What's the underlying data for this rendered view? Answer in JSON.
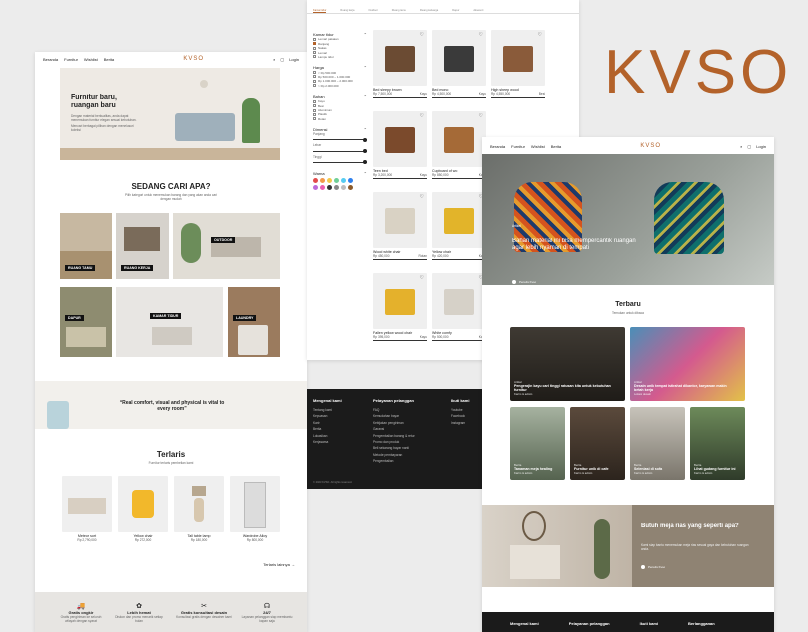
{
  "brand": {
    "logo": "KVSO",
    "accent": "#b3622a"
  },
  "nav": {
    "links": [
      "Beranda",
      "Furnitur",
      "Wishlist",
      "Berita"
    ],
    "login": "Login"
  },
  "home": {
    "hero_title": "Furnitur baru, ruangan baru",
    "hero_text": "Dengan material berkualitas, anda dapat menemukan furnitur elegan sesuai kebutuhan.",
    "hero_text2": "Mencari berbagai pilihan dengan menelusuri koleksi",
    "search_heading": "SEDANG CARI APA?",
    "search_sub": "Pilih kategori untuk menemukan barang dan yang akan anda cari dengan mudah",
    "rooms": [
      "RUANG TAMU",
      "RUANG KERJA",
      "OUTDOOR",
      "DAPUR",
      "KAMAR TIDUR",
      "LAUNDRY"
    ],
    "quote": "“Real comfort, visual and physical is vital to every room”",
    "bestseller_title": "Terlaris",
    "bestseller_sub": "Furnitur terlaris pembelian kami",
    "bestsellers": [
      {
        "name": "Meteor sort",
        "price": "Rp 2,790,000"
      },
      {
        "name": "Yellow chair",
        "price": "Rp 272,000"
      },
      {
        "name": "Tall table lamp",
        "price": "Rp 180,000"
      },
      {
        "name": "Wardrobe Alloy",
        "price": "Rp 800,000"
      }
    ],
    "see_more": "Terlaris lainnya  →",
    "features": [
      {
        "title": "Gratis ongkir",
        "text": "Gratis pengiriman ke seluruh wilayah dengan syarat"
      },
      {
        "title": "Lebih hemat",
        "text": "Diskon dan promo menarik setiap bulan"
      },
      {
        "title": "Gratis konsultasi desain",
        "text": "Konsultasi gratis dengan desainer kami"
      },
      {
        "title": "24/7",
        "text": "Layanan pelanggan siap membantu kapan saja"
      }
    ]
  },
  "catalog": {
    "tabs": [
      "Kamar tidur",
      "Ruang kerja",
      "Outdoor",
      "Ruang tamu",
      "Ruang keluarga",
      "Dapur",
      "Aksesori"
    ],
    "filters": {
      "kamar_tidur_label": "Kamar tidur",
      "kamar_tidur_items": [
        "Lemari pakaian",
        "Ranjang",
        "Nakas",
        "Lemari",
        "Lampu tidur"
      ],
      "harga_label": "Harga",
      "harga_items": [
        "< Rp 500.000",
        "Rp 500.000 – 1.000.000",
        "Rp 1.000.000 – 2.000.000",
        "> Rp 2.000.000"
      ],
      "bahan_label": "Bahan",
      "bahan_items": [
        "Kayu",
        "Besi",
        "Aluminium",
        "Plastik",
        "Rotan"
      ],
      "dimensi_label": "Dimensi",
      "panjang": "Panjang",
      "lebar": "Lebar",
      "tinggi": "Tinggi",
      "warna_label": "Warna"
    },
    "products": [
      {
        "name": "Bed sleepy brown",
        "price": "Rp 7,500,000",
        "tag": "Kayu"
      },
      {
        "name": "Bed mono",
        "price": "Rp 4,500,000",
        "tag": "Kayu"
      },
      {
        "name": "High sheep wood",
        "price": "Rp 4,550,000",
        "tag": "Besi"
      },
      {
        "name": "Teen bed",
        "price": "Rp 3,200,000",
        "tag": "Kayu"
      },
      {
        "name": "Cupboard of wo",
        "price": "Rp 850,000",
        "tag": "Kayu"
      },
      {
        "name": "",
        "price": "",
        "tag": ""
      },
      {
        "name": "Wood white chair",
        "price": "Rp 450,000",
        "tag": "Rotan"
      },
      {
        "name": "Yellow chair",
        "price": "Rp 420,000",
        "tag": "Kayu"
      },
      {
        "name": "",
        "price": "",
        "tag": ""
      },
      {
        "name": "Fallen yellow wood chair",
        "price": "Rp 395,000",
        "tag": "Kayu"
      },
      {
        "name": "White comfy",
        "price": "Rp 500,000",
        "tag": "Kayu"
      }
    ],
    "swatches": [
      "#e24b4b",
      "#f2994a",
      "#f2c94c",
      "#6fcf97",
      "#56ccf2",
      "#2f80ed",
      "#bb6bd9",
      "#eb5fb0",
      "#333333",
      "#888888",
      "#bdbdbd",
      "#8b5a2b"
    ]
  },
  "footer_mid": {
    "col1_title": "Mengenal kami",
    "col1": [
      "Tentang kami",
      "Kepuasan",
      "Karir",
      "Berita",
      "Lokasikan",
      "Kerjasama"
    ],
    "col2_title": "Pelayanan pelanggan",
    "col2": [
      "FAQ",
      "Kemudahan bayar",
      "Kebijakan pengiriman",
      "Garansi",
      "Pengembalian barang & retur",
      "Promo dan produk",
      "Beli sekarang bayar nanti",
      "Metode pembayaran",
      "Pengembalian"
    ],
    "col3_title": "Ikuti kami",
    "col3": [
      "Youtube",
      "Facebook",
      "Instagram"
    ],
    "copyright": "© 2023 KVSO. All rights reserved."
  },
  "blog": {
    "hero_tag": "Artikel",
    "hero_title": "Bahan material ini bisa mempercantik ruangan agar lebih nyaman di tempati",
    "hero_author": "Penulis Kvso",
    "section_title": "Terbaru",
    "section_sub": "Temukan untuk dibaca",
    "articles": [
      {
        "tag": "Artikel",
        "title": "Pengerajin kayu cari tinggi ratusan kita untuk kebutuhan furnitur",
        "meta": "Karim & admin"
      },
      {
        "tag": "Artikel",
        "title": "Desain unik tempat istirahat dikantor, karyawan makin betah kerja",
        "meta": "Lokasi desain"
      },
      {
        "tag": "Berita",
        "title": "Tanaman meja healing",
        "meta": "Karim & admin"
      },
      {
        "tag": "Berita",
        "title": "Furnitur unik di cafe",
        "meta": "Karim & admin"
      },
      {
        "tag": "Berita",
        "title": "Seleniasi di sofa",
        "meta": "Karim & admin"
      },
      {
        "tag": "Berita",
        "title": "Lihat gudang furnitur ini",
        "meta": "Karim & admin"
      }
    ],
    "promo_title": "Butuh meja rias yang seperti apa?",
    "promo_text": "Kami siap bantu menemukan meja rias sesuai gaya dan kebutuhan ruangan anda.",
    "promo_author": "Penulis Kvso",
    "footer_cols": [
      "Mengenal kami",
      "Pelayanan pelanggan",
      "Ikuti kami",
      "Berlangganan"
    ]
  }
}
